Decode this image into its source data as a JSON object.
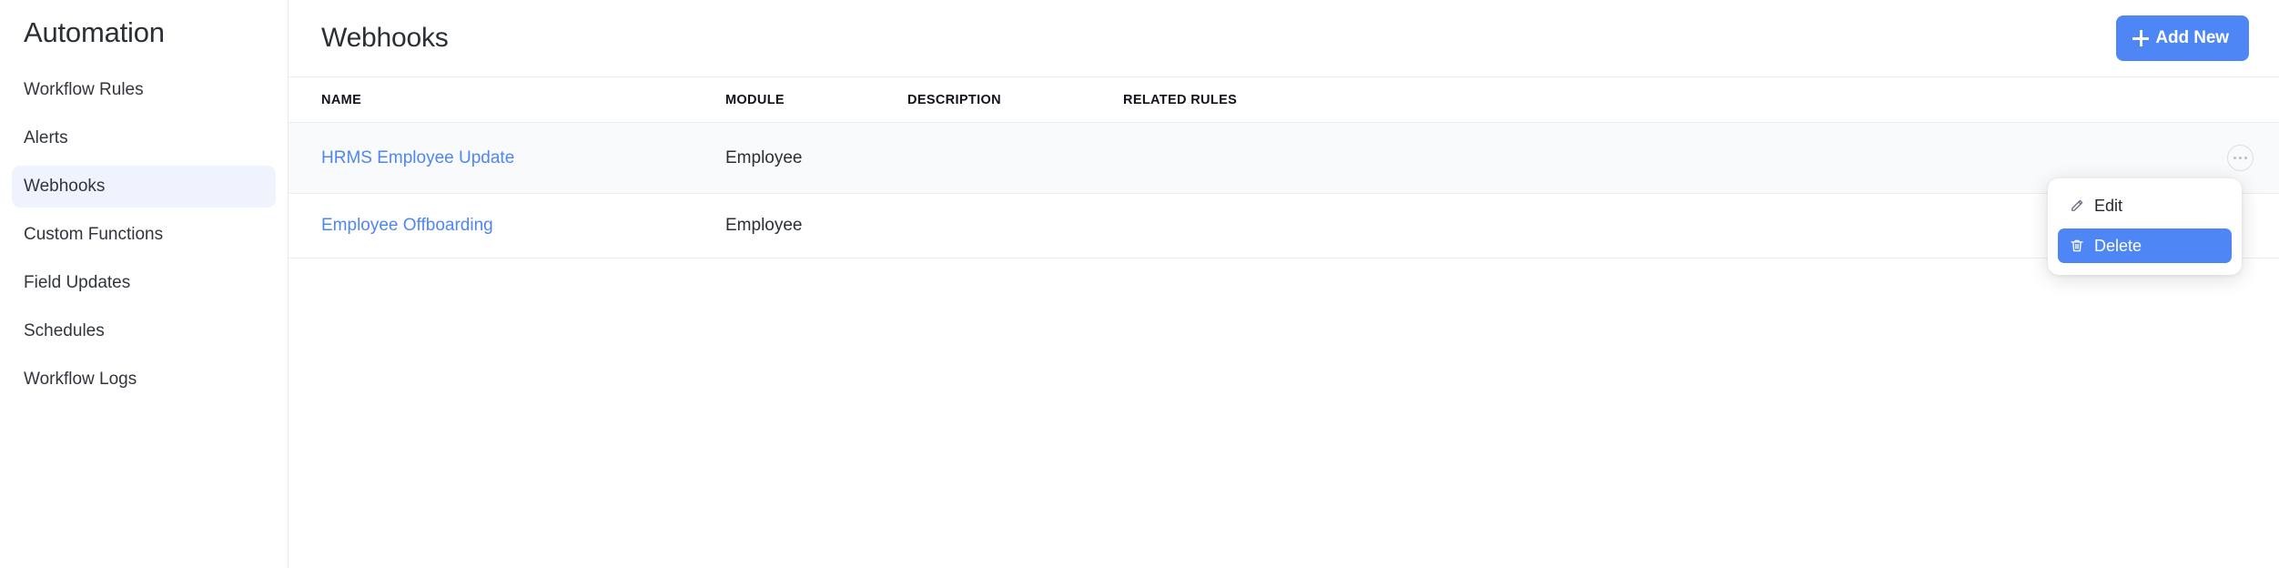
{
  "sidebar": {
    "title": "Automation",
    "items": [
      {
        "label": "Workflow Rules",
        "active": false
      },
      {
        "label": "Alerts",
        "active": false
      },
      {
        "label": "Webhooks",
        "active": true
      },
      {
        "label": "Custom Functions",
        "active": false
      },
      {
        "label": "Field Updates",
        "active": false
      },
      {
        "label": "Schedules",
        "active": false
      },
      {
        "label": "Workflow Logs",
        "active": false
      }
    ]
  },
  "header": {
    "title": "Webhooks",
    "add_button_label": "Add New",
    "add_button_icon": "plus-icon",
    "accent_color": "#4f86f5"
  },
  "table": {
    "columns": [
      "NAME",
      "MODULE",
      "DESCRIPTION",
      "RELATED RULES"
    ],
    "rows": [
      {
        "name": "HRMS Employee Update",
        "module": "Employee",
        "description": "",
        "related_rules": "",
        "hovered": true
      },
      {
        "name": "Employee Offboarding",
        "module": "Employee",
        "description": "",
        "related_rules": "",
        "hovered": false
      }
    ],
    "row_action_icon": "ellipsis-icon"
  },
  "context_menu": {
    "items": [
      {
        "label": "Edit",
        "icon": "pencil-icon",
        "selected": false
      },
      {
        "label": "Delete",
        "icon": "trash-icon",
        "selected": true
      }
    ],
    "highlight_color": "#4f86f5"
  }
}
